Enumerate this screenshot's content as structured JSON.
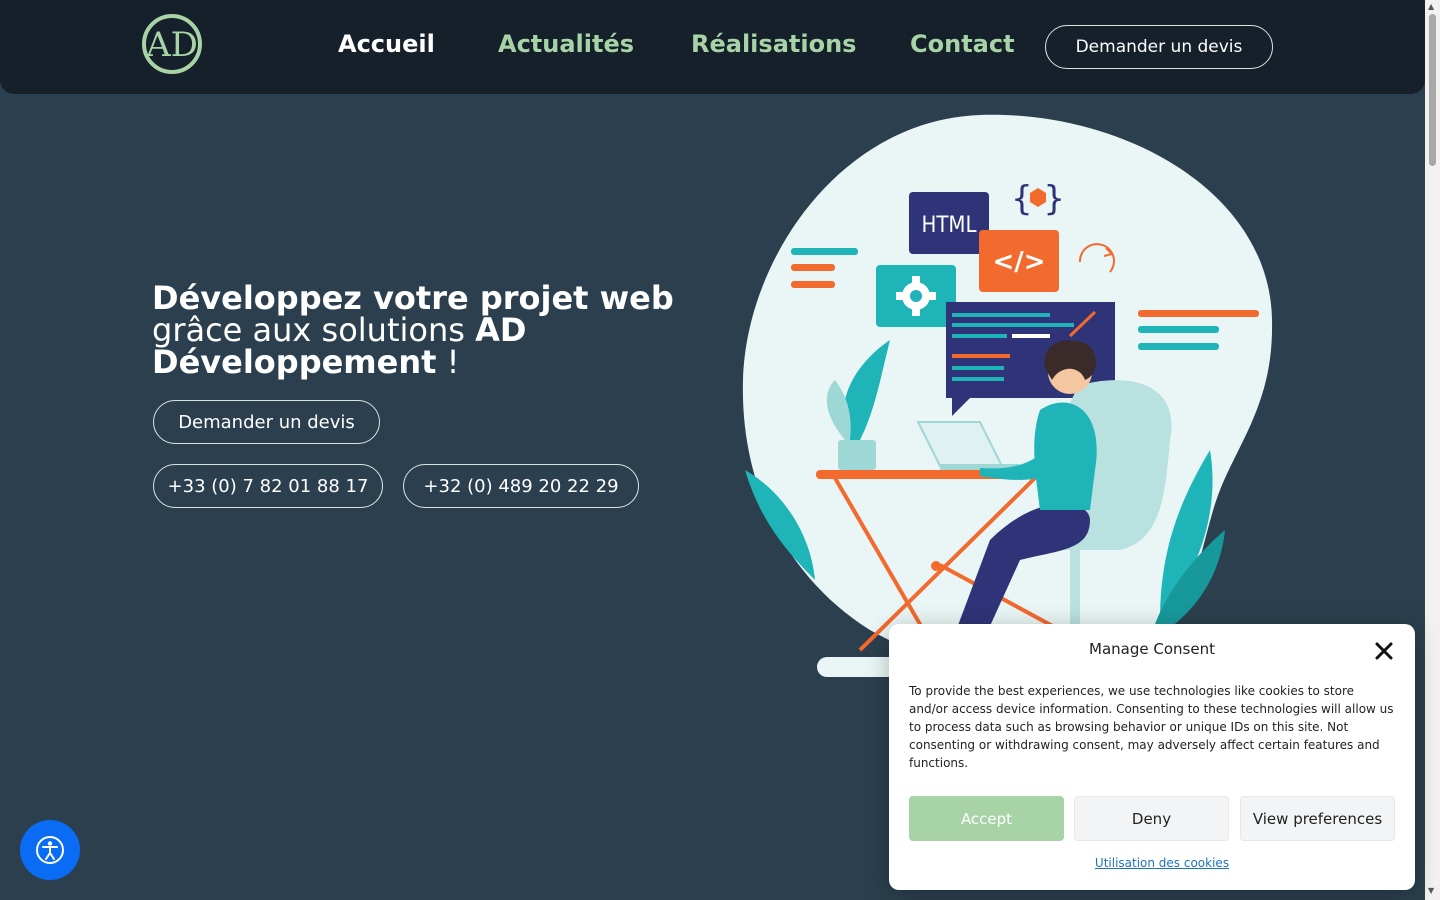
{
  "header": {
    "logo_text": "AD",
    "nav": [
      {
        "label": "Accueil",
        "active": true
      },
      {
        "label": "Actualités",
        "active": false
      },
      {
        "label": "Réalisations",
        "active": false
      },
      {
        "label": "Contact",
        "active": false
      }
    ],
    "cta_label": "Demander un devis"
  },
  "hero": {
    "line1": "Développez votre projet web",
    "line2_light": "grâce aux solutions",
    "line2_bold": "AD",
    "line3_bold": "Développement",
    "line3_end": " !",
    "quote_button": "Demander un devis",
    "phone_fr": "+33 (0) 7 82 01 88 17",
    "phone_be": "+32 (0) 489 20 22 29",
    "illustration": {
      "html_label": "HTML",
      "code_label": "</>",
      "braces_label": "{ }"
    }
  },
  "consent": {
    "title": "Manage Consent",
    "text": "To provide the best experiences, we use technologies like cookies to store and/or access device information. Consenting to these technologies will allow us to process data such as browsing behavior or unique IDs on this site. Not consenting or withdrawing consent, may adversely affect certain features and functions.",
    "accept": "Accept",
    "deny": "Deny",
    "preferences": "View preferences",
    "policy_link": "Utilisation des cookies"
  },
  "colors": {
    "background": "#2b3f4e",
    "header": "#15202a",
    "accent_green": "#a7d3a6",
    "teal": "#1fb5b8",
    "orange": "#f26a2e",
    "navy": "#2f3478",
    "a11y_blue": "#0a6cf5"
  },
  "icons": {
    "accessibility": "accessibility-icon",
    "close": "close-icon",
    "gear": "gear-icon",
    "refresh": "refresh-icon"
  }
}
